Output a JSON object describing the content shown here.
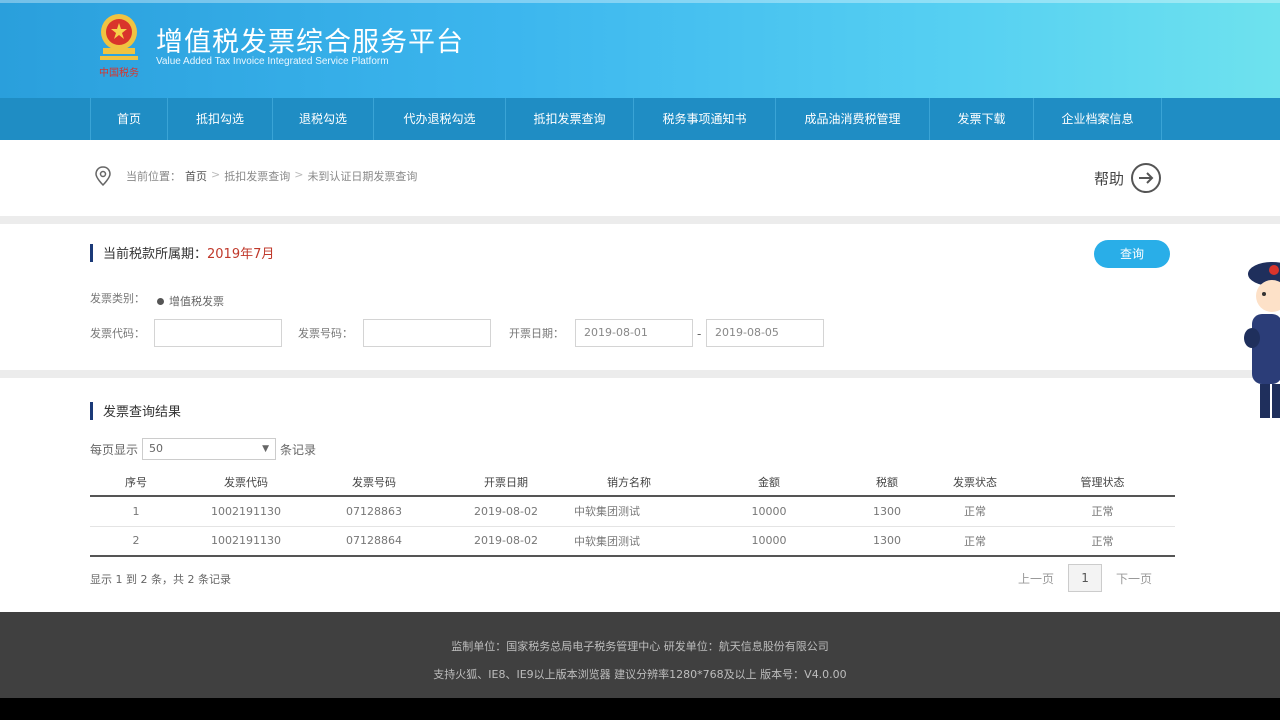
{
  "header": {
    "title": "增值税发票综合服务平台",
    "subtitle": "Value Added Tax Invoice Integrated Service Platform",
    "emblem_text": "中国税务",
    "colors": {
      "primary": "#2a9fdc",
      "nav": "#1f8dc4",
      "accent": "#29aee8",
      "highlight": "#c0392b"
    }
  },
  "nav": {
    "items": [
      "首页",
      "抵扣勾选",
      "退税勾选",
      "代办退税勾选",
      "抵扣发票查询",
      "税务事项通知书",
      "成品油消费税管理",
      "发票下载",
      "企业档案信息"
    ]
  },
  "breadcrumb": {
    "prefix": "当前位置：",
    "home": "首页",
    "sep": ">",
    "level2": "抵扣发票查询",
    "level3": "未到认证日期发票查询",
    "help_label": "帮助"
  },
  "query": {
    "title_label": "当前税款所属期：",
    "title_value": "2019年7月",
    "button_label": "查询",
    "invoice_type_label": "发票类别：",
    "invoice_type_value": "增值税发票",
    "code_label": "发票代码：",
    "code_value": "",
    "number_label": "发票号码：",
    "number_value": "",
    "date_label": "开票日期：",
    "date_from": "2019-08-01",
    "date_sep": "-",
    "date_to": "2019-08-05"
  },
  "results": {
    "title": "发票查询结果",
    "per_page_label": "每页显示",
    "per_page_value": "50",
    "per_page_suffix": "条记录",
    "columns": [
      "序号",
      "发票代码",
      "发票号码",
      "开票日期",
      "销方名称",
      "金额",
      "税额",
      "发票状态",
      "管理状态"
    ],
    "rows": [
      [
        "1",
        "1002191130",
        "07128863",
        "2019-08-02",
        "中软集团测试",
        "10000",
        "1300",
        "正常",
        "正常"
      ],
      [
        "2",
        "1002191130",
        "07128864",
        "2019-08-02",
        "中软集团测试",
        "10000",
        "1300",
        "正常",
        "正常"
      ]
    ],
    "summary": "显示 1 到 2 条，共 2 条记录",
    "pager": {
      "prev": "上一页",
      "current": "1",
      "next": "下一页"
    }
  },
  "footer": {
    "line1": "监制单位：国家税务总局电子税务管理中心    研发单位：航天信息股份有限公司",
    "line2": "支持火狐、IE8、IE9以上版本浏览器    建议分辨率1280*768及以上    版本号：V4.0.00"
  }
}
